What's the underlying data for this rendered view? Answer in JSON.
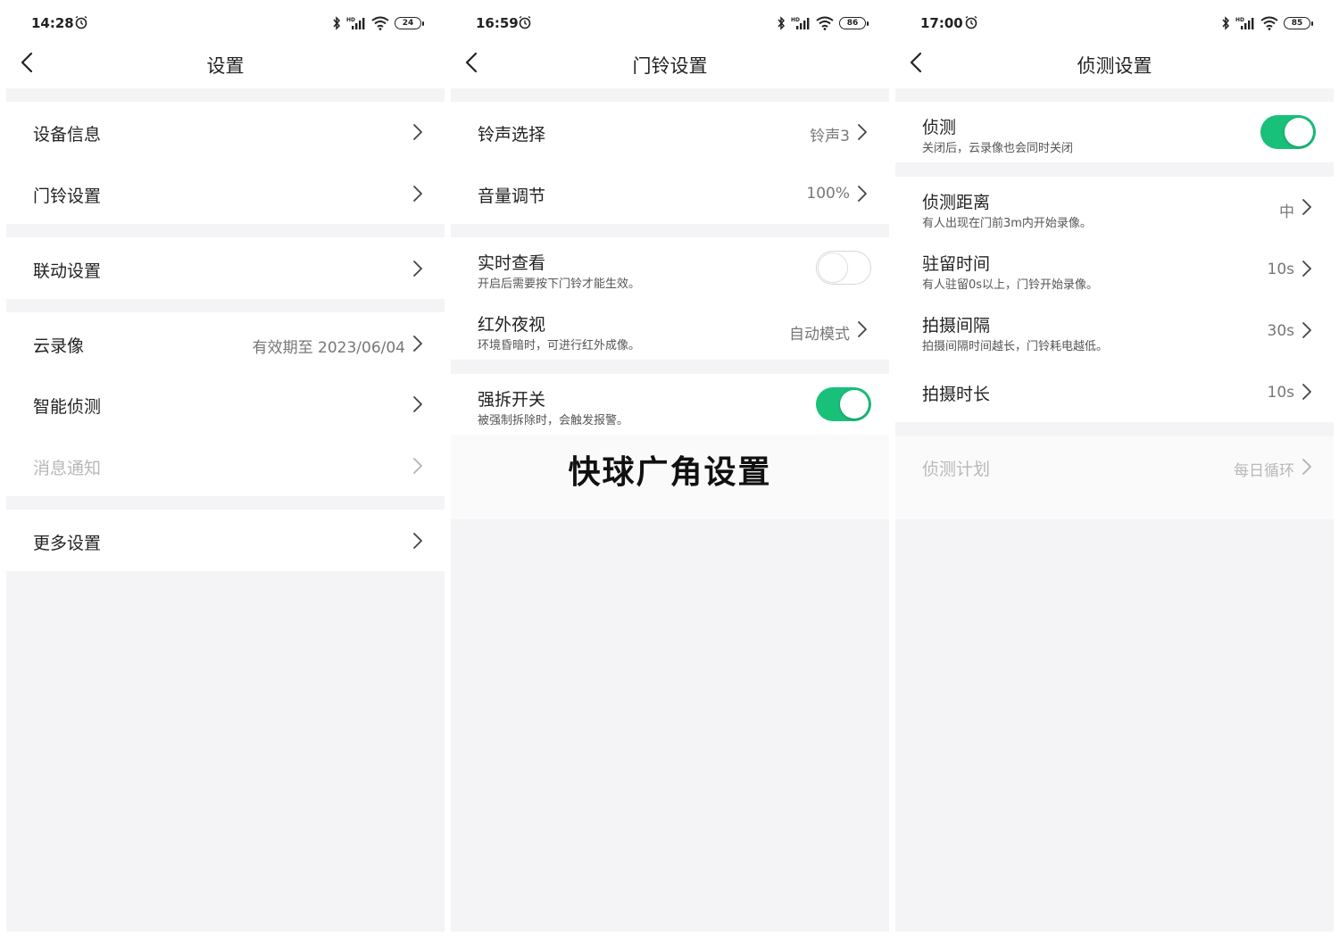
{
  "screens": [
    {
      "status": {
        "time": "14:28",
        "battery": "24"
      },
      "title": "设置",
      "rows": [
        {
          "label": "设备信息"
        },
        {
          "label": "门铃设置"
        },
        {
          "label": "联动设置"
        },
        {
          "label": "云录像",
          "value": "有效期至 2023/06/04"
        },
        {
          "label": "智能侦测"
        },
        {
          "label": "消息通知",
          "disabled": true
        },
        {
          "label": "更多设置"
        }
      ]
    },
    {
      "status": {
        "time": "16:59",
        "battery": "86"
      },
      "title": "门铃设置",
      "rows": [
        {
          "label": "铃声选择",
          "value": "铃声3"
        },
        {
          "label": "音量调节",
          "value": "100%"
        },
        {
          "label": "实时查看",
          "sub": "开启后需要按下门铃才能生效。",
          "toggle": false
        },
        {
          "label": "红外夜视",
          "sub": "环境昏暗时，可进行红外成像。",
          "value": "自动模式"
        },
        {
          "label": "强拆开关",
          "sub": "被强制拆除时，会触发报警。",
          "toggle": true
        }
      ]
    },
    {
      "status": {
        "time": "17:00",
        "battery": "85"
      },
      "title": "侦测设置",
      "rows": [
        {
          "label": "侦测",
          "sub": "关闭后，云录像也会同时关闭",
          "toggle": true
        },
        {
          "label": "侦测距离",
          "sub": "有人出现在门前3m内开始录像。",
          "value": "中"
        },
        {
          "label": "驻留时间",
          "sub": "有人驻留0s以上，门铃开始录像。",
          "value": "10s"
        },
        {
          "label": "拍摄间隔",
          "sub": "拍摄间隔时间越长，门铃耗电越低。",
          "value": "30s"
        },
        {
          "label": "拍摄时长",
          "value": "10s"
        },
        {
          "label": "侦测计划",
          "value": "每日循环",
          "disabled": true
        }
      ]
    }
  ],
  "caption": "快球广角设置",
  "colors": {
    "accent": "#19c07a",
    "background": "#f4f4f6",
    "disabled": "#b8b8b8"
  }
}
